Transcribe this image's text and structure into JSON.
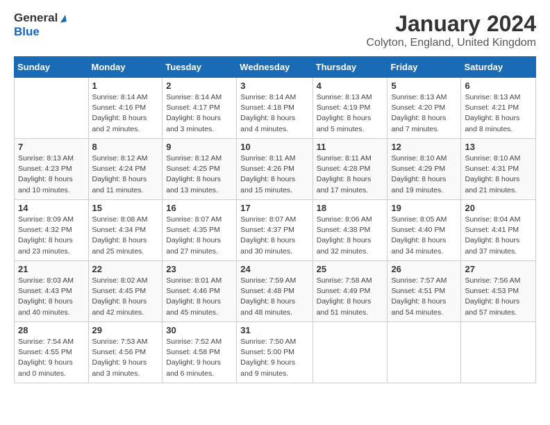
{
  "header": {
    "logo_general": "General",
    "logo_blue": "Blue",
    "month_year": "January 2024",
    "location": "Colyton, England, United Kingdom"
  },
  "weekdays": [
    "Sunday",
    "Monday",
    "Tuesday",
    "Wednesday",
    "Thursday",
    "Friday",
    "Saturday"
  ],
  "weeks": [
    [
      {
        "day": "",
        "sunrise": "",
        "sunset": "",
        "daylight": ""
      },
      {
        "day": "1",
        "sunrise": "Sunrise: 8:14 AM",
        "sunset": "Sunset: 4:16 PM",
        "daylight": "Daylight: 8 hours and 2 minutes."
      },
      {
        "day": "2",
        "sunrise": "Sunrise: 8:14 AM",
        "sunset": "Sunset: 4:17 PM",
        "daylight": "Daylight: 8 hours and 3 minutes."
      },
      {
        "day": "3",
        "sunrise": "Sunrise: 8:14 AM",
        "sunset": "Sunset: 4:18 PM",
        "daylight": "Daylight: 8 hours and 4 minutes."
      },
      {
        "day": "4",
        "sunrise": "Sunrise: 8:13 AM",
        "sunset": "Sunset: 4:19 PM",
        "daylight": "Daylight: 8 hours and 5 minutes."
      },
      {
        "day": "5",
        "sunrise": "Sunrise: 8:13 AM",
        "sunset": "Sunset: 4:20 PM",
        "daylight": "Daylight: 8 hours and 7 minutes."
      },
      {
        "day": "6",
        "sunrise": "Sunrise: 8:13 AM",
        "sunset": "Sunset: 4:21 PM",
        "daylight": "Daylight: 8 hours and 8 minutes."
      }
    ],
    [
      {
        "day": "7",
        "sunrise": "Sunrise: 8:13 AM",
        "sunset": "Sunset: 4:23 PM",
        "daylight": "Daylight: 8 hours and 10 minutes."
      },
      {
        "day": "8",
        "sunrise": "Sunrise: 8:12 AM",
        "sunset": "Sunset: 4:24 PM",
        "daylight": "Daylight: 8 hours and 11 minutes."
      },
      {
        "day": "9",
        "sunrise": "Sunrise: 8:12 AM",
        "sunset": "Sunset: 4:25 PM",
        "daylight": "Daylight: 8 hours and 13 minutes."
      },
      {
        "day": "10",
        "sunrise": "Sunrise: 8:11 AM",
        "sunset": "Sunset: 4:26 PM",
        "daylight": "Daylight: 8 hours and 15 minutes."
      },
      {
        "day": "11",
        "sunrise": "Sunrise: 8:11 AM",
        "sunset": "Sunset: 4:28 PM",
        "daylight": "Daylight: 8 hours and 17 minutes."
      },
      {
        "day": "12",
        "sunrise": "Sunrise: 8:10 AM",
        "sunset": "Sunset: 4:29 PM",
        "daylight": "Daylight: 8 hours and 19 minutes."
      },
      {
        "day": "13",
        "sunrise": "Sunrise: 8:10 AM",
        "sunset": "Sunset: 4:31 PM",
        "daylight": "Daylight: 8 hours and 21 minutes."
      }
    ],
    [
      {
        "day": "14",
        "sunrise": "Sunrise: 8:09 AM",
        "sunset": "Sunset: 4:32 PM",
        "daylight": "Daylight: 8 hours and 23 minutes."
      },
      {
        "day": "15",
        "sunrise": "Sunrise: 8:08 AM",
        "sunset": "Sunset: 4:34 PM",
        "daylight": "Daylight: 8 hours and 25 minutes."
      },
      {
        "day": "16",
        "sunrise": "Sunrise: 8:07 AM",
        "sunset": "Sunset: 4:35 PM",
        "daylight": "Daylight: 8 hours and 27 minutes."
      },
      {
        "day": "17",
        "sunrise": "Sunrise: 8:07 AM",
        "sunset": "Sunset: 4:37 PM",
        "daylight": "Daylight: 8 hours and 30 minutes."
      },
      {
        "day": "18",
        "sunrise": "Sunrise: 8:06 AM",
        "sunset": "Sunset: 4:38 PM",
        "daylight": "Daylight: 8 hours and 32 minutes."
      },
      {
        "day": "19",
        "sunrise": "Sunrise: 8:05 AM",
        "sunset": "Sunset: 4:40 PM",
        "daylight": "Daylight: 8 hours and 34 minutes."
      },
      {
        "day": "20",
        "sunrise": "Sunrise: 8:04 AM",
        "sunset": "Sunset: 4:41 PM",
        "daylight": "Daylight: 8 hours and 37 minutes."
      }
    ],
    [
      {
        "day": "21",
        "sunrise": "Sunrise: 8:03 AM",
        "sunset": "Sunset: 4:43 PM",
        "daylight": "Daylight: 8 hours and 40 minutes."
      },
      {
        "day": "22",
        "sunrise": "Sunrise: 8:02 AM",
        "sunset": "Sunset: 4:45 PM",
        "daylight": "Daylight: 8 hours and 42 minutes."
      },
      {
        "day": "23",
        "sunrise": "Sunrise: 8:01 AM",
        "sunset": "Sunset: 4:46 PM",
        "daylight": "Daylight: 8 hours and 45 minutes."
      },
      {
        "day": "24",
        "sunrise": "Sunrise: 7:59 AM",
        "sunset": "Sunset: 4:48 PM",
        "daylight": "Daylight: 8 hours and 48 minutes."
      },
      {
        "day": "25",
        "sunrise": "Sunrise: 7:58 AM",
        "sunset": "Sunset: 4:49 PM",
        "daylight": "Daylight: 8 hours and 51 minutes."
      },
      {
        "day": "26",
        "sunrise": "Sunrise: 7:57 AM",
        "sunset": "Sunset: 4:51 PM",
        "daylight": "Daylight: 8 hours and 54 minutes."
      },
      {
        "day": "27",
        "sunrise": "Sunrise: 7:56 AM",
        "sunset": "Sunset: 4:53 PM",
        "daylight": "Daylight: 8 hours and 57 minutes."
      }
    ],
    [
      {
        "day": "28",
        "sunrise": "Sunrise: 7:54 AM",
        "sunset": "Sunset: 4:55 PM",
        "daylight": "Daylight: 9 hours and 0 minutes."
      },
      {
        "day": "29",
        "sunrise": "Sunrise: 7:53 AM",
        "sunset": "Sunset: 4:56 PM",
        "daylight": "Daylight: 9 hours and 3 minutes."
      },
      {
        "day": "30",
        "sunrise": "Sunrise: 7:52 AM",
        "sunset": "Sunset: 4:58 PM",
        "daylight": "Daylight: 9 hours and 6 minutes."
      },
      {
        "day": "31",
        "sunrise": "Sunrise: 7:50 AM",
        "sunset": "Sunset: 5:00 PM",
        "daylight": "Daylight: 9 hours and 9 minutes."
      },
      {
        "day": "",
        "sunrise": "",
        "sunset": "",
        "daylight": ""
      },
      {
        "day": "",
        "sunrise": "",
        "sunset": "",
        "daylight": ""
      },
      {
        "day": "",
        "sunrise": "",
        "sunset": "",
        "daylight": ""
      }
    ]
  ]
}
